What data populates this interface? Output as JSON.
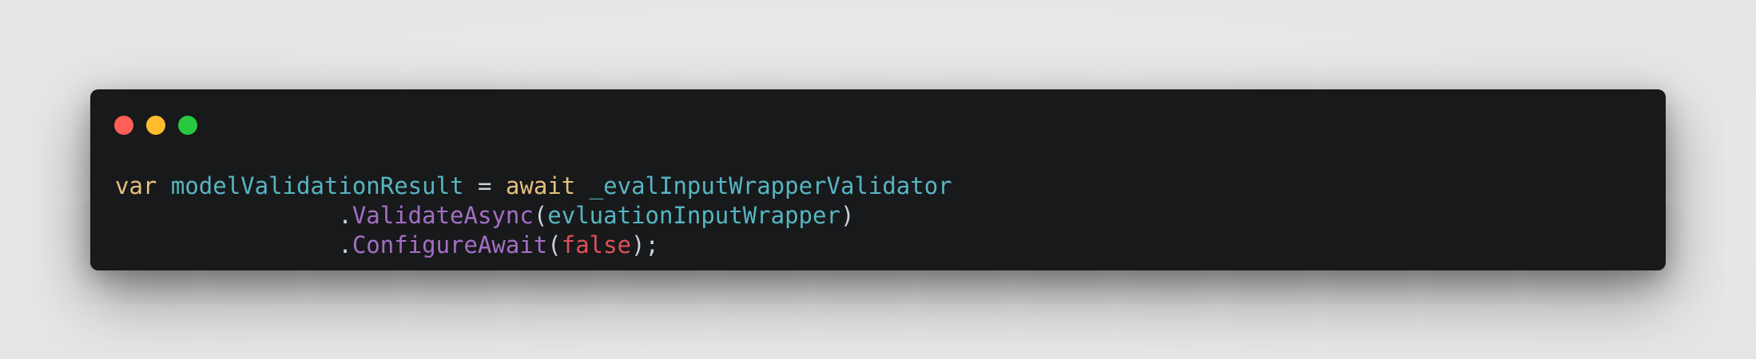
{
  "window": {
    "controls": {
      "close_color": "#ff5f57",
      "minimize_color": "#febc2e",
      "maximize_color": "#28c840"
    }
  },
  "code": {
    "lines": [
      {
        "indent": "",
        "tokens": [
          {
            "text": "var",
            "kind": "kw"
          },
          {
            "text": " ",
            "kind": "plain"
          },
          {
            "text": "modelValidationResult",
            "kind": "ident"
          },
          {
            "text": " = ",
            "kind": "plain"
          },
          {
            "text": "await",
            "kind": "kw"
          },
          {
            "text": " ",
            "kind": "plain"
          },
          {
            "text": "_evalInputWrapperValidator",
            "kind": "ident"
          }
        ]
      },
      {
        "indent": "                ",
        "tokens": [
          {
            "text": ".",
            "kind": "plain"
          },
          {
            "text": "ValidateAsync",
            "kind": "method"
          },
          {
            "text": "(",
            "kind": "plain"
          },
          {
            "text": "evluationInputWrapper",
            "kind": "ident"
          },
          {
            "text": ")",
            "kind": "plain"
          }
        ]
      },
      {
        "indent": "                ",
        "tokens": [
          {
            "text": ".",
            "kind": "plain"
          },
          {
            "text": "ConfigureAwait",
            "kind": "method"
          },
          {
            "text": "(",
            "kind": "plain"
          },
          {
            "text": "false",
            "kind": "lit"
          },
          {
            "text": ");",
            "kind": "plain"
          }
        ]
      }
    ]
  },
  "colors": {
    "window_bg": "#18191b",
    "page_bg": "#e6e6e6",
    "keyword": "#e5c07b",
    "identifier": "#56b6c2",
    "method": "#a46fc5",
    "literal": "#e0515a",
    "punctuation": "#c9d1d9"
  }
}
